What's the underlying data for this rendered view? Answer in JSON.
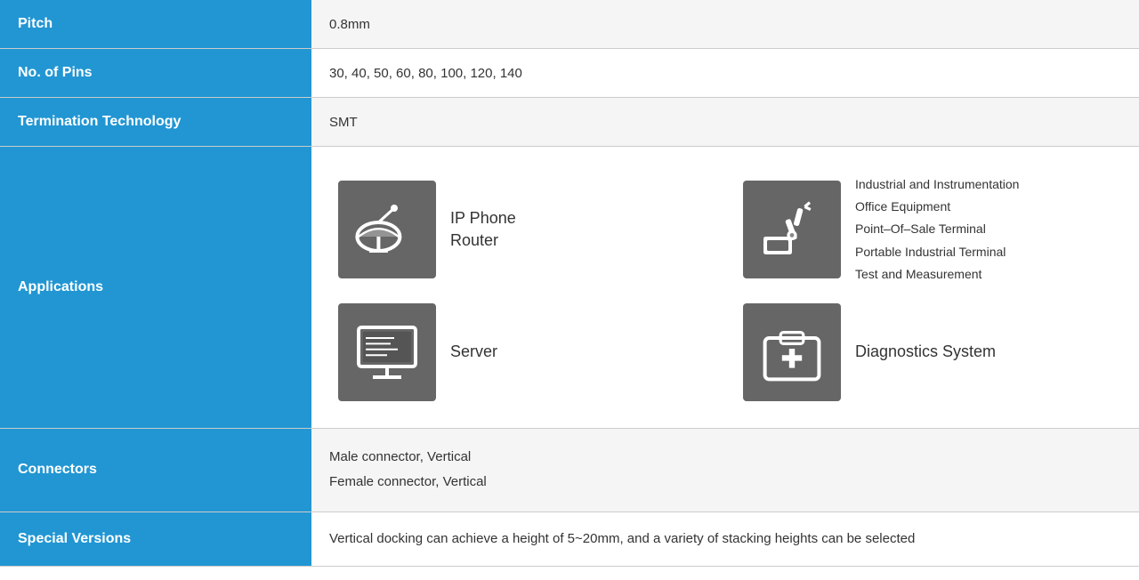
{
  "rows": {
    "pitch": {
      "label": "Pitch",
      "value": "0.8mm"
    },
    "pins": {
      "label": "No. of Pins",
      "value": "30, 40, 50, 60, 80, 100, 120, 140"
    },
    "termination": {
      "label": "Termination Technology",
      "value": "SMT"
    },
    "applications": {
      "label": "Applications",
      "items": [
        {
          "id": "ip-phone",
          "label": "IP Phone\nRouter",
          "icon": "satellite"
        },
        {
          "id": "industrial",
          "label": "Industrial and Instrumentation\nOffice Equipment\nPoint–Of–Sale Terminal\nPortable Industrial Terminal\nTest and Measurement",
          "icon": "industrial",
          "multiline": true
        },
        {
          "id": "server",
          "label": "Server",
          "icon": "server"
        },
        {
          "id": "diagnostics",
          "label": "Diagnostics System",
          "icon": "diagnostics"
        }
      ]
    },
    "connectors": {
      "label": "Connectors",
      "line1": "Male connector, Vertical",
      "line2": "Female connector, Vertical"
    },
    "special": {
      "label": "Special Versions",
      "value": "Vertical docking can achieve a height of 5~20mm, and a variety of stacking heights can be selected"
    }
  }
}
